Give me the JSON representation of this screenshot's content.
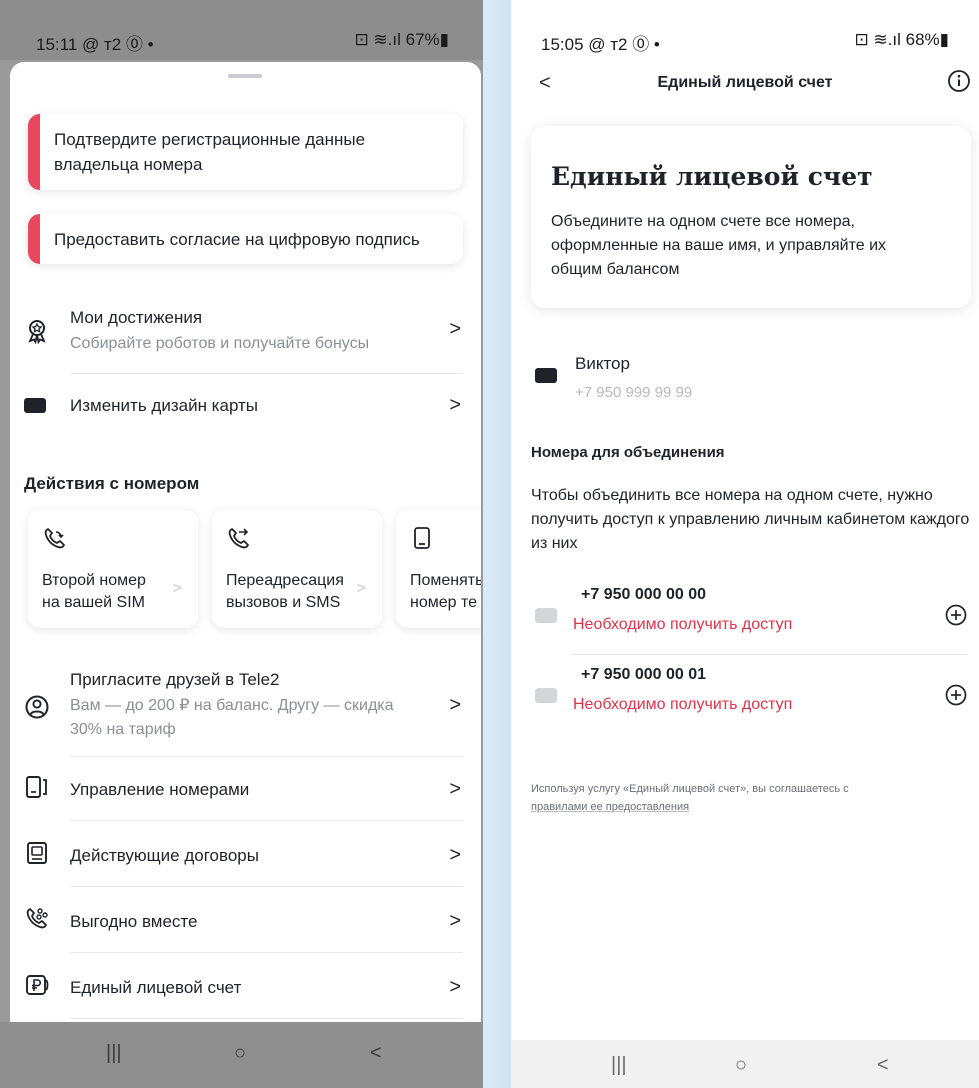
{
  "left_screen": {
    "status_bar": {
      "time": "15:11 @ т2 ⓪ •",
      "indicators": "⊡ ≋.ıl 67%▮"
    },
    "alerts": [
      {
        "text": "Подтвердите регистрационные данные владельца номера"
      },
      {
        "text": "Предоставить согласие на цифровую подпись"
      }
    ],
    "achievements": {
      "title": "Мои достижения",
      "subtitle": "Собирайте роботов и получайте бонусы"
    },
    "card_design": {
      "title": "Изменить дизайн карты"
    },
    "actions_section": {
      "title": "Действия с номером",
      "cards": [
        {
          "label": "Второй номер на вашей SIM",
          "icon": "phone-swap-icon"
        },
        {
          "label": "Переадресация вызовов и SMS",
          "icon": "phone-forward-icon"
        },
        {
          "label": "Поменять номер те",
          "icon": "smartphone-icon"
        }
      ]
    },
    "invite": {
      "title": "Пригласите друзей в Tele2",
      "subtitle": "Вам — до 200 ₽ на баланс. Другу — скидка 30% на тариф"
    },
    "menu": [
      {
        "label": "Управление номерами",
        "icon": "numbers-icon"
      },
      {
        "label": "Действующие договоры",
        "icon": "contracts-icon"
      },
      {
        "label": "Выгодно вместе",
        "icon": "together-icon"
      },
      {
        "label": "Единый лицевой счет",
        "icon": "ruble-account-icon"
      }
    ],
    "chevron": ">",
    "nav": {
      "recents": "|||",
      "home": "○",
      "back": "<"
    }
  },
  "right_screen": {
    "status_bar": {
      "time": "15:05 @ т2 ⓪ •",
      "indicators": "⊡ ≋.ıl 68%▮"
    },
    "topbar": {
      "back": "<",
      "title": "Единый лицевой счет"
    },
    "hero": {
      "title": "Единый лицевой счет",
      "description": "Объедините на одном счете все номера, оформленные на ваше имя, и управляйте их общим балансом"
    },
    "owner": {
      "name": "Виктор",
      "phone": "+7 950 999 99 99"
    },
    "merge_section": {
      "title": "Номера для объединения",
      "description": "Чтобы объединить все номера на одном счете, нужно получить доступ к управлению личным кабинетом каждого из них"
    },
    "numbers": [
      {
        "number": "+7 950 000 00 00",
        "status": "Необходимо получить доступ"
      },
      {
        "number": "+7 950 000 00 01",
        "status": "Необходимо получить доступ"
      }
    ],
    "footnote": {
      "text": "Используя услугу «Единый лицевой счет», вы соглашаетесь с",
      "link": "правилами ее предоставления"
    },
    "nav": {
      "recents": "|||",
      "home": "○",
      "back": "<"
    }
  },
  "colors": {
    "accent_red": "#e8475e",
    "error_red": "#e0334b",
    "text_dark": "#1f2229",
    "text_muted": "#8b8e95"
  }
}
